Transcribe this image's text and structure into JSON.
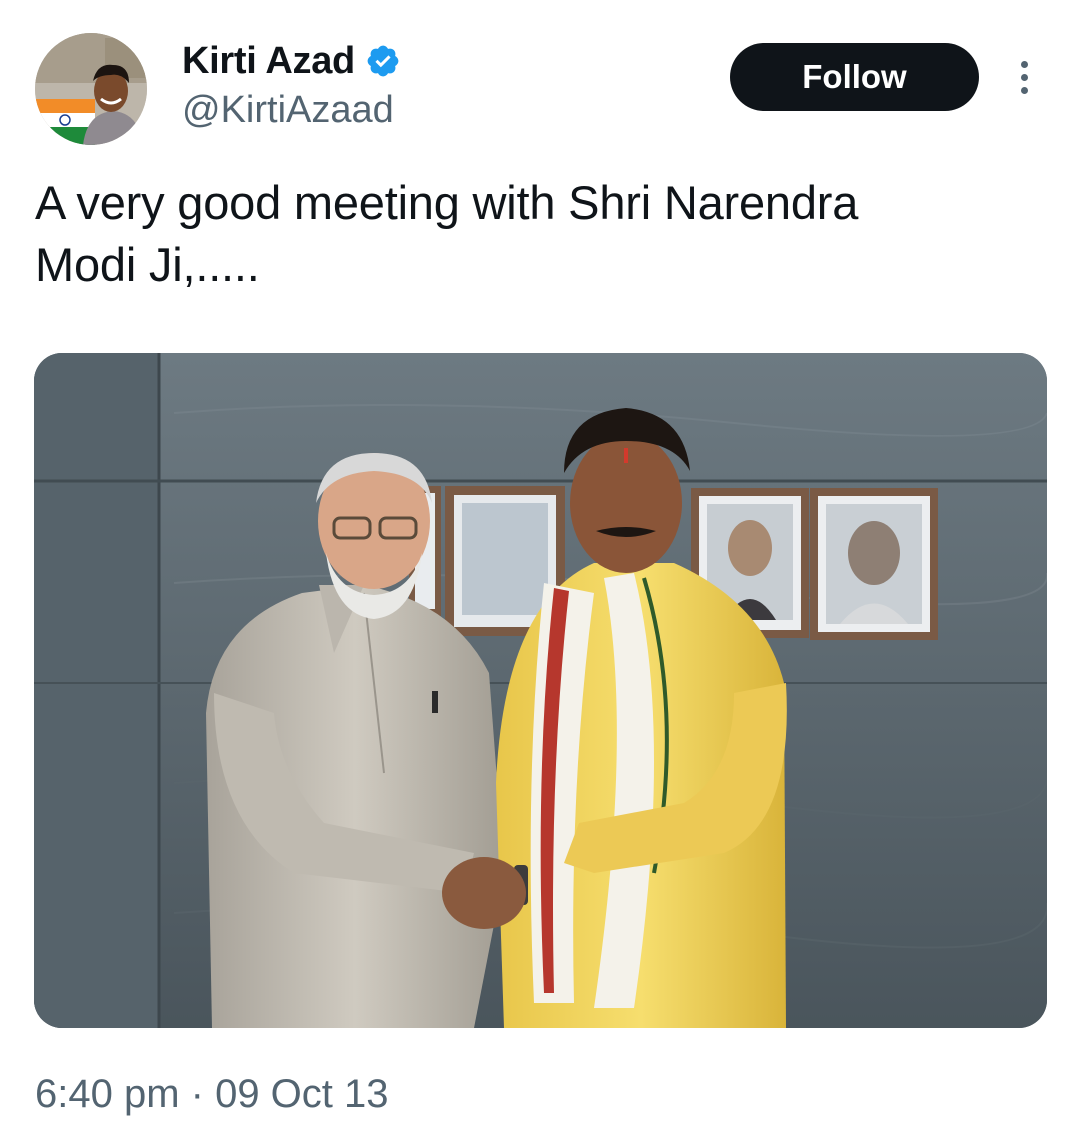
{
  "author": {
    "display_name": "Kirti Azad",
    "handle": "@KirtiAzaad",
    "verified": true,
    "avatar_icon": "profile-photo-avatar"
  },
  "actions": {
    "follow_label": "Follow",
    "more_icon": "more-options-icon"
  },
  "tweet": {
    "text": "A very good meeting with Shri Narendra\nModi Ji,.....",
    "media_icon": "photo-handshake-meeting"
  },
  "meta": {
    "time": "6:40 pm",
    "separator": " · ",
    "date": "09 Oct 13"
  },
  "colors": {
    "text_primary": "#0f1419",
    "text_secondary": "#536471",
    "verified_blue": "#1d9bf0",
    "follow_bg": "#0f1419"
  }
}
